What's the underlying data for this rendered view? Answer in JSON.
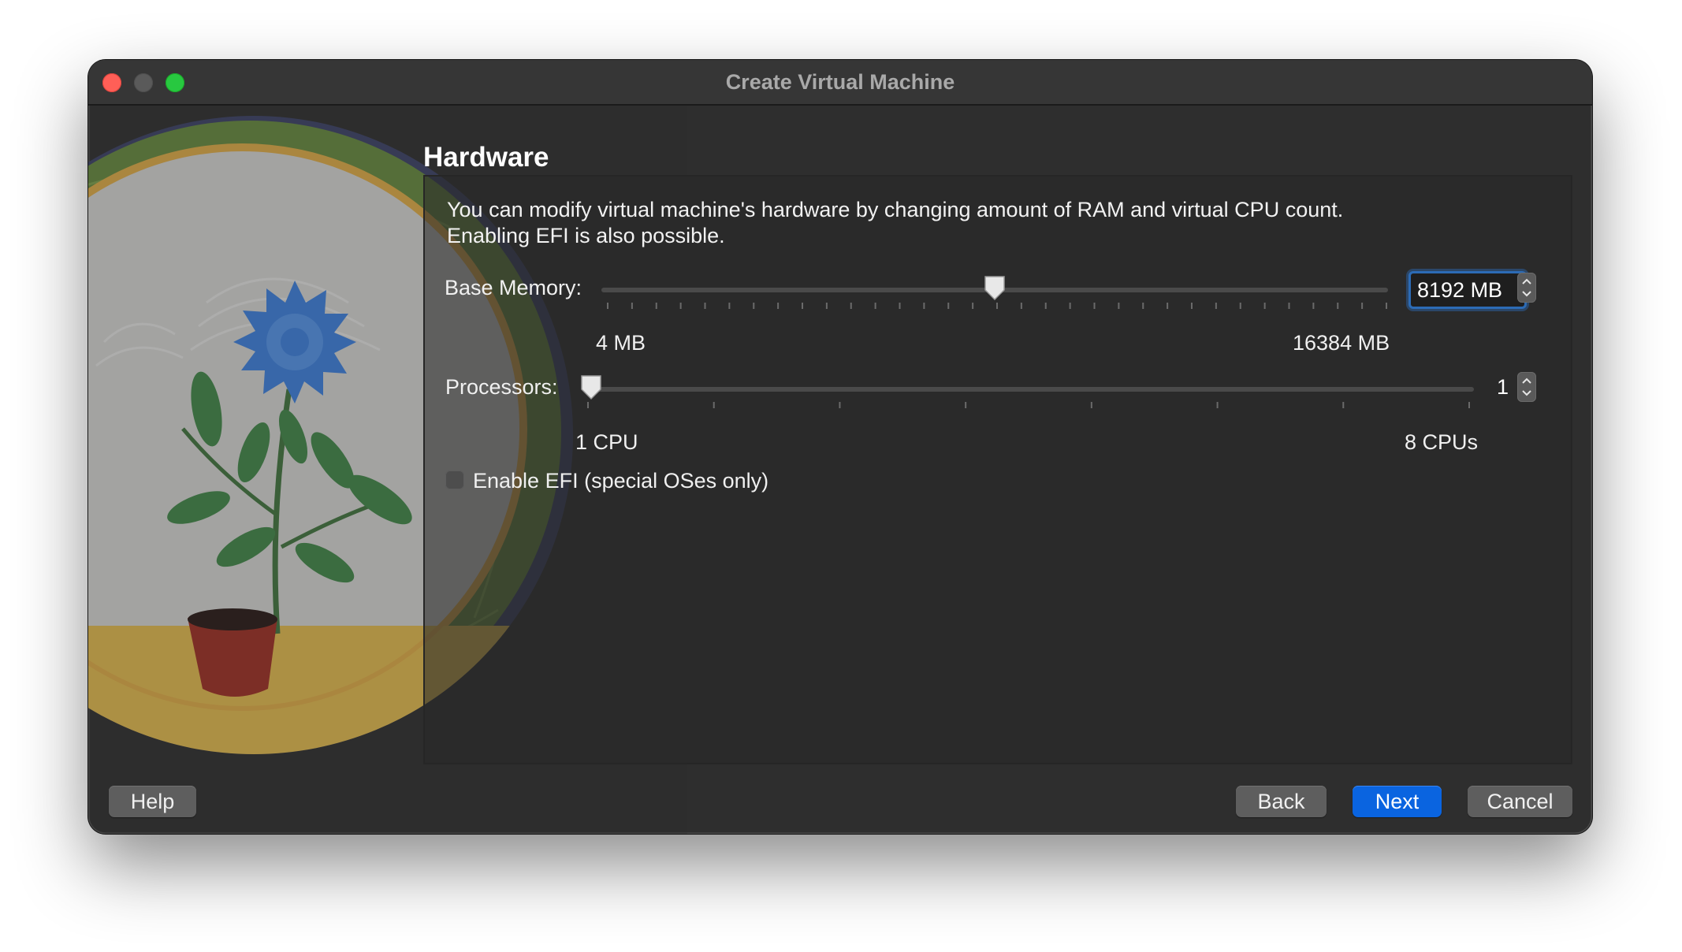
{
  "window": {
    "title": "Create Virtual Machine"
  },
  "page": {
    "section_title": "Hardware",
    "description_line1": "You can modify virtual machine's hardware by changing amount of RAM and virtual CPU count.",
    "description_line2": "Enabling EFI is also possible."
  },
  "memory": {
    "label": "Base Memory:",
    "value_text": "8192 MB",
    "min_label": "4 MB",
    "max_label": "16384 MB",
    "min": 4,
    "max": 16384,
    "value": 8192
  },
  "processors": {
    "label": "Processors:",
    "value_text": "1",
    "min_label": "1 CPU",
    "max_label": "8 CPUs",
    "min": 1,
    "max": 8,
    "value": 1
  },
  "efi": {
    "label": "Enable EFI (special OSes only)",
    "checked": false
  },
  "buttons": {
    "help": "Help",
    "back": "Back",
    "next": "Next",
    "cancel": "Cancel"
  },
  "colors": {
    "accent": "#0a64e0",
    "window_bg": "#2e2e2e",
    "focus_ring": "#2c6bb5"
  }
}
